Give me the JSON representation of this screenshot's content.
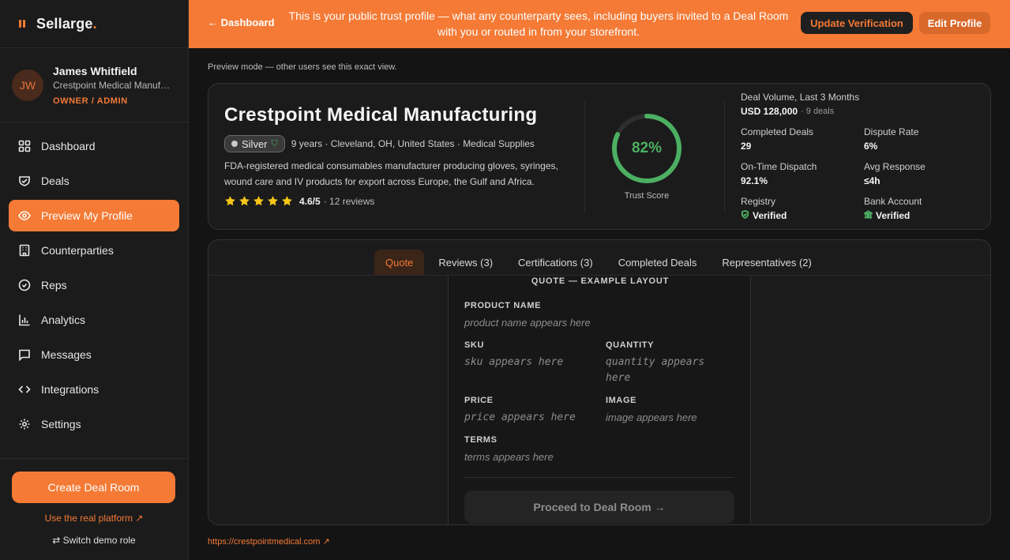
{
  "app": {
    "brand": "Sellarge",
    "brand_dot": "."
  },
  "user": {
    "initials": "JW",
    "name": "James Whitfield",
    "company": "Crestpoint Medical Manufacturing",
    "role": "OWNER / ADMIN"
  },
  "sidebar": {
    "items": [
      {
        "label": "Dashboard",
        "icon": "grid-icon",
        "active": false
      },
      {
        "label": "Deals",
        "icon": "handshake-icon",
        "active": false
      },
      {
        "label": "Preview My Profile",
        "icon": "eye-icon",
        "active": true
      },
      {
        "label": "Counterparties",
        "icon": "building-icon",
        "active": false
      },
      {
        "label": "Reps",
        "icon": "check-circle-icon",
        "active": false
      },
      {
        "label": "Analytics",
        "icon": "bar-chart-icon",
        "active": false
      },
      {
        "label": "Messages",
        "icon": "message-icon",
        "active": false
      },
      {
        "label": "Integrations",
        "icon": "code-icon",
        "active": false
      },
      {
        "label": "Settings",
        "icon": "gear-icon",
        "active": false
      }
    ],
    "create_button": "Create Deal Room",
    "real_platform_link": "Use the real platform ↗",
    "switch_role": "Switch demo role"
  },
  "banner": {
    "back_label": "Dashboard",
    "message": "This is your public trust profile — what any counterparty sees, including buyers invited to a Deal Room with you or routed in from your storefront.",
    "update_button": "Update Verification",
    "edit_button": "Edit Profile"
  },
  "preview_note": "Preview mode — other users see this exact view.",
  "profile": {
    "company_name": "Crestpoint Medical Manufacturing",
    "tier": "Silver",
    "meta": "9 years · Cleveland, OH, United States · Medical Supplies",
    "description": "FDA-registered medical consumables manufacturer producing gloves, syringes, wound care and IV products for export across Europe, the Gulf and Africa.",
    "rating": "4.6/5",
    "reviews": "· 12 reviews",
    "stars": 5
  },
  "trust": {
    "score": 82,
    "score_label": "82%",
    "label": "Trust Score"
  },
  "stats": {
    "deal_volume_label": "Deal Volume, Last 3 Months",
    "deal_volume_value": "USD 128,000",
    "deal_volume_sub": "· 9 deals",
    "completed_label": "Completed Deals",
    "completed_value": "29",
    "dispute_label": "Dispute Rate",
    "dispute_value": "6%",
    "ontime_label": "On-Time Dispatch",
    "ontime_value": "92.1%",
    "response_label": "Avg Response",
    "response_value": "≤4h",
    "registry_label": "Registry",
    "registry_value": "Verified",
    "bank_label": "Bank Account",
    "bank_value": "Verified"
  },
  "tabs": [
    {
      "label": "Quote",
      "active": true
    },
    {
      "label": "Reviews (3)",
      "active": false
    },
    {
      "label": "Certifications (3)",
      "active": false
    },
    {
      "label": "Completed Deals",
      "active": false
    },
    {
      "label": "Representatives (2)",
      "active": false
    }
  ],
  "quote": {
    "heading": "QUOTE — EXAMPLE LAYOUT",
    "product_label": "PRODUCT NAME",
    "product_ph": "product name appears here",
    "sku_label": "SKU",
    "sku_ph": "sku appears here",
    "qty_label": "QUANTITY",
    "qty_ph": "quantity appears here",
    "price_label": "PRICE",
    "price_ph": "price appears here",
    "image_label": "IMAGE",
    "image_ph": "image appears here",
    "terms_label": "TERMS",
    "terms_ph": "terms appears here",
    "proceed_button": "Proceed to Deal Room →"
  },
  "website": "https://crestpointmedical.com ↗",
  "colors": {
    "accent": "#f47a35",
    "success": "#4caf62",
    "star": "#f5c518"
  }
}
